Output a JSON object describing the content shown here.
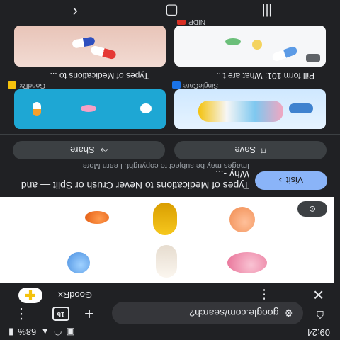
{
  "status_bar": {
    "time": "09:24",
    "battery": "68%"
  },
  "browser": {
    "url": "google.com/search?",
    "tab_count": "15",
    "icons": [
      "home-icon",
      "site-info-icon",
      "new-tab-icon",
      "tab-switcher-icon",
      "more-vert-icon"
    ]
  },
  "result": {
    "source_name": "GoodRx",
    "title": "Types of Medications to Never Crush or Split — and Why -...",
    "copyright_note": "Images may be subject to copyright. Learn More",
    "visit_label": "Visit",
    "share_label": "Share",
    "save_label": "Save"
  },
  "related": [
    {
      "source": "GoodRx",
      "caption": "Types of Medications to ...",
      "favicon_color": "#f4c20d"
    },
    {
      "source": "SingleCare",
      "caption": "Pill form 101: What are t...",
      "favicon_color": "#1a73e8"
    },
    {
      "source": "",
      "caption": ""
    },
    {
      "source": "NIDP",
      "caption": ""
    }
  ]
}
